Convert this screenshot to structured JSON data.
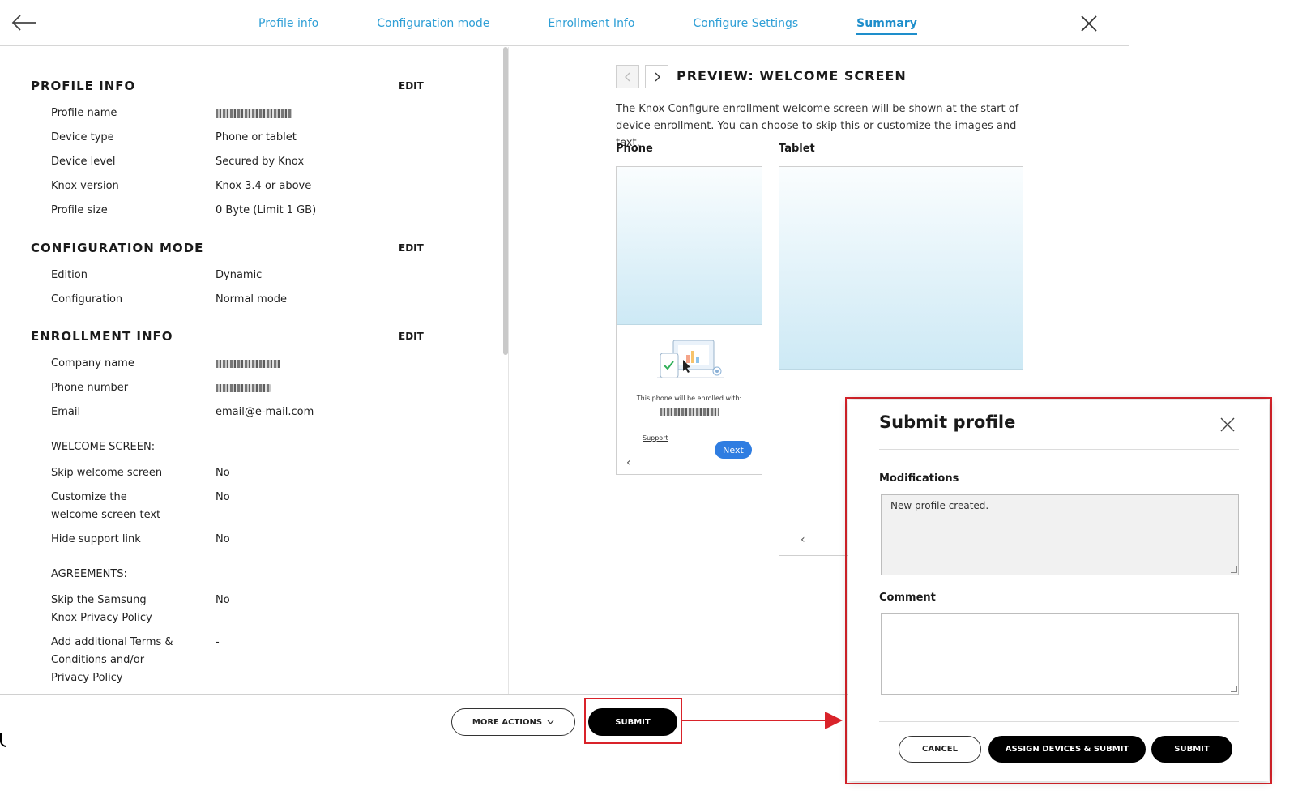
{
  "header": {
    "back_icon": "arrow-left-icon",
    "close_icon": "close-icon",
    "steps": [
      {
        "label": "Profile info"
      },
      {
        "label": "Configuration mode"
      },
      {
        "label": "Enrollment Info"
      },
      {
        "label": "Configure Settings"
      },
      {
        "label": "Summary",
        "active": true
      }
    ]
  },
  "summary": {
    "edit_label": "EDIT",
    "profile_info": {
      "title": "PROFILE INFO",
      "rows": [
        {
          "label": "Profile name",
          "value": ""
        },
        {
          "label": "Device type",
          "value": "Phone or tablet"
        },
        {
          "label": "Device level",
          "value": "Secured by Knox"
        },
        {
          "label": "Knox version",
          "value": "Knox 3.4 or above"
        },
        {
          "label": "Profile size",
          "value": "0 Byte (Limit 1 GB)"
        }
      ]
    },
    "configuration_mode": {
      "title": "CONFIGURATION MODE",
      "rows": [
        {
          "label": "Edition",
          "value": "Dynamic"
        },
        {
          "label": "Configuration",
          "value": "Normal mode"
        }
      ]
    },
    "enrollment_info": {
      "title": "ENROLLMENT INFO",
      "rows": [
        {
          "label": "Company name",
          "value": ""
        },
        {
          "label": "Phone number",
          "value": ""
        },
        {
          "label": "Email",
          "value": "email@e-mail.com"
        }
      ],
      "welcome_screen_heading": "WELCOME SCREEN:",
      "welcome_rows": [
        {
          "label": "Skip welcome screen",
          "value": "No"
        },
        {
          "label": "Customize the welcome screen text",
          "value": "No"
        },
        {
          "label": "Hide support link",
          "value": "No"
        }
      ],
      "agreements_heading": "AGREEMENTS:",
      "agreement_rows": [
        {
          "label": "Skip the Samsung Knox Privacy Policy",
          "value": "No"
        },
        {
          "label": "Add additional Terms & Conditions and/or Privacy Policy",
          "value": "-"
        }
      ]
    }
  },
  "preview": {
    "title": "PREVIEW: WELCOME SCREEN",
    "description": "The Knox Configure enrollment welcome screen will be shown at the start of device enrollment. You can choose to skip this or customize the images and text.",
    "phone_label": "Phone",
    "tablet_label": "Tablet",
    "phone_screen": {
      "enroll_text": "This phone will be enrolled with:",
      "support_link": "Support",
      "next_button": "Next"
    }
  },
  "footer": {
    "more_actions": "MORE ACTIONS",
    "submit": "SUBMIT"
  },
  "modal": {
    "title": "Submit profile",
    "modifications_label": "Modifications",
    "modifications_value": "New profile created.",
    "comment_label": "Comment",
    "comment_value": "",
    "cancel": "CANCEL",
    "assign_submit": "ASSIGN DEVICES & SUBMIT",
    "submit": "SUBMIT"
  },
  "colors": {
    "accent": "#2f9fd6",
    "highlight": "#d9232a",
    "primary_button": "#000000",
    "phone_next_button": "#2f7de1"
  }
}
